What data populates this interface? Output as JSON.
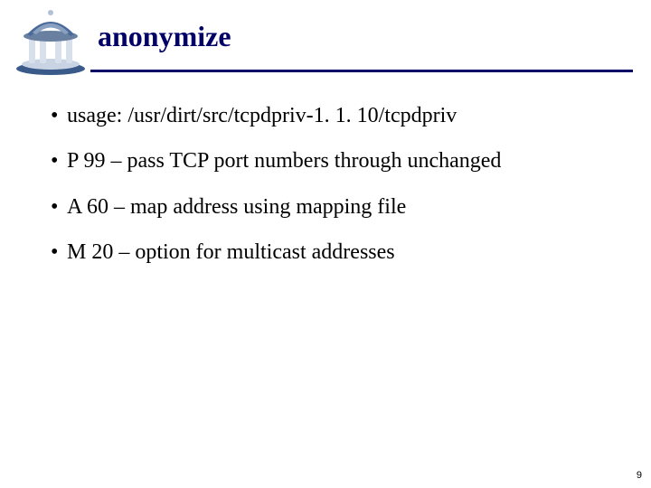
{
  "title": "anonymize",
  "bullets": [
    "usage: /usr/dirt/src/tcpdpriv-1. 1. 10/tcpdpriv",
    "P 99 – pass TCP port numbers through unchanged",
    "A 60 – map address using mapping file",
    "M 20 – option for multicast addresses"
  ],
  "page_number": "9"
}
